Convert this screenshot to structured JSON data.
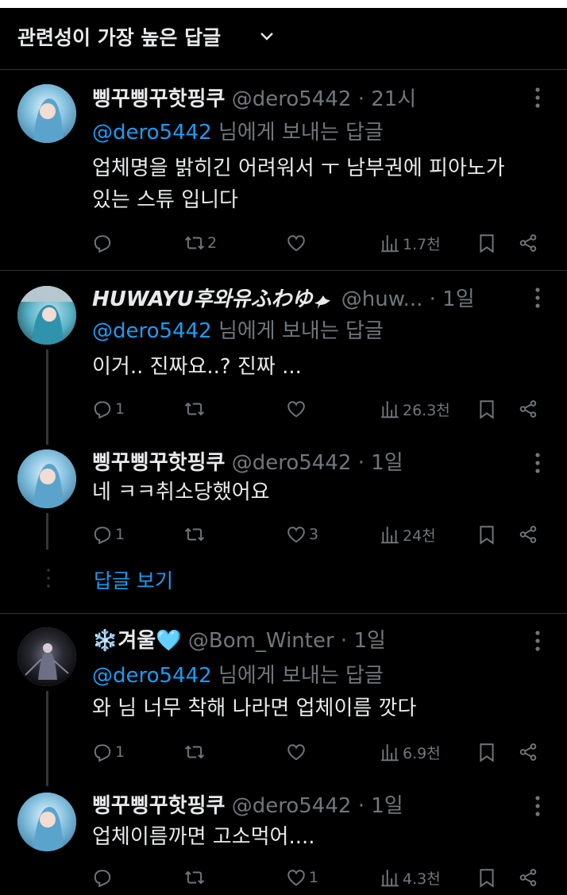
{
  "header": {
    "title": "관련성이 가장 높은 답글"
  },
  "replying_prefix_mention": "@dero5442",
  "replying_suffix": " 님에게 보내는 답글",
  "show_replies_label": "답글 보기",
  "colors": {
    "accent": "#1d9bf0",
    "muted": "#71767b",
    "text": "#e7e9ea",
    "background": "#000000"
  },
  "posts": [
    {
      "display_name": "삥꾸삥꾸핫핑쿠",
      "handle": "@dero5442",
      "time": "· 21시",
      "replying": true,
      "text_lines": [
        "업체명을 밝히긴 어려워서 ㅜ 남부권에 피아노가",
        "있는 스튜 입니다"
      ],
      "reply_count": "",
      "repost_count": "2",
      "like_count": "",
      "views": "1.7천"
    },
    {
      "display_name": "HUWAYU후와유ふわゆ",
      "handle": "@huw...",
      "time": "· 1일",
      "replying": true,
      "text_lines": [
        "이거.. 진짜요..? 진짜 ..."
      ],
      "reply_count": "1",
      "repost_count": "",
      "like_count": "",
      "views": "26.3천"
    },
    {
      "display_name": "삥꾸삥꾸핫핑쿠",
      "handle": "@dero5442",
      "time": "· 1일",
      "replying": false,
      "text_lines": [
        "네 ㅋㅋ취소당했어요"
      ],
      "reply_count": "1",
      "repost_count": "",
      "like_count": "3",
      "views": "24천"
    },
    {
      "display_name": "❄️겨울🩵",
      "handle": "@Bom_Winter",
      "time": "· 1일",
      "replying": true,
      "text_lines": [
        "와 님 너무 착해 나라면 업체이름 깟다"
      ],
      "reply_count": "1",
      "repost_count": "",
      "like_count": "",
      "views": "6.9천"
    },
    {
      "display_name": "삥꾸삥꾸핫핑쿠",
      "handle": "@dero5442",
      "time": "· 1일",
      "replying": false,
      "text_lines": [
        "업체이름까면 고소먹어...."
      ],
      "reply_count": "",
      "repost_count": "",
      "like_count": "1",
      "views": "4.3천"
    }
  ]
}
